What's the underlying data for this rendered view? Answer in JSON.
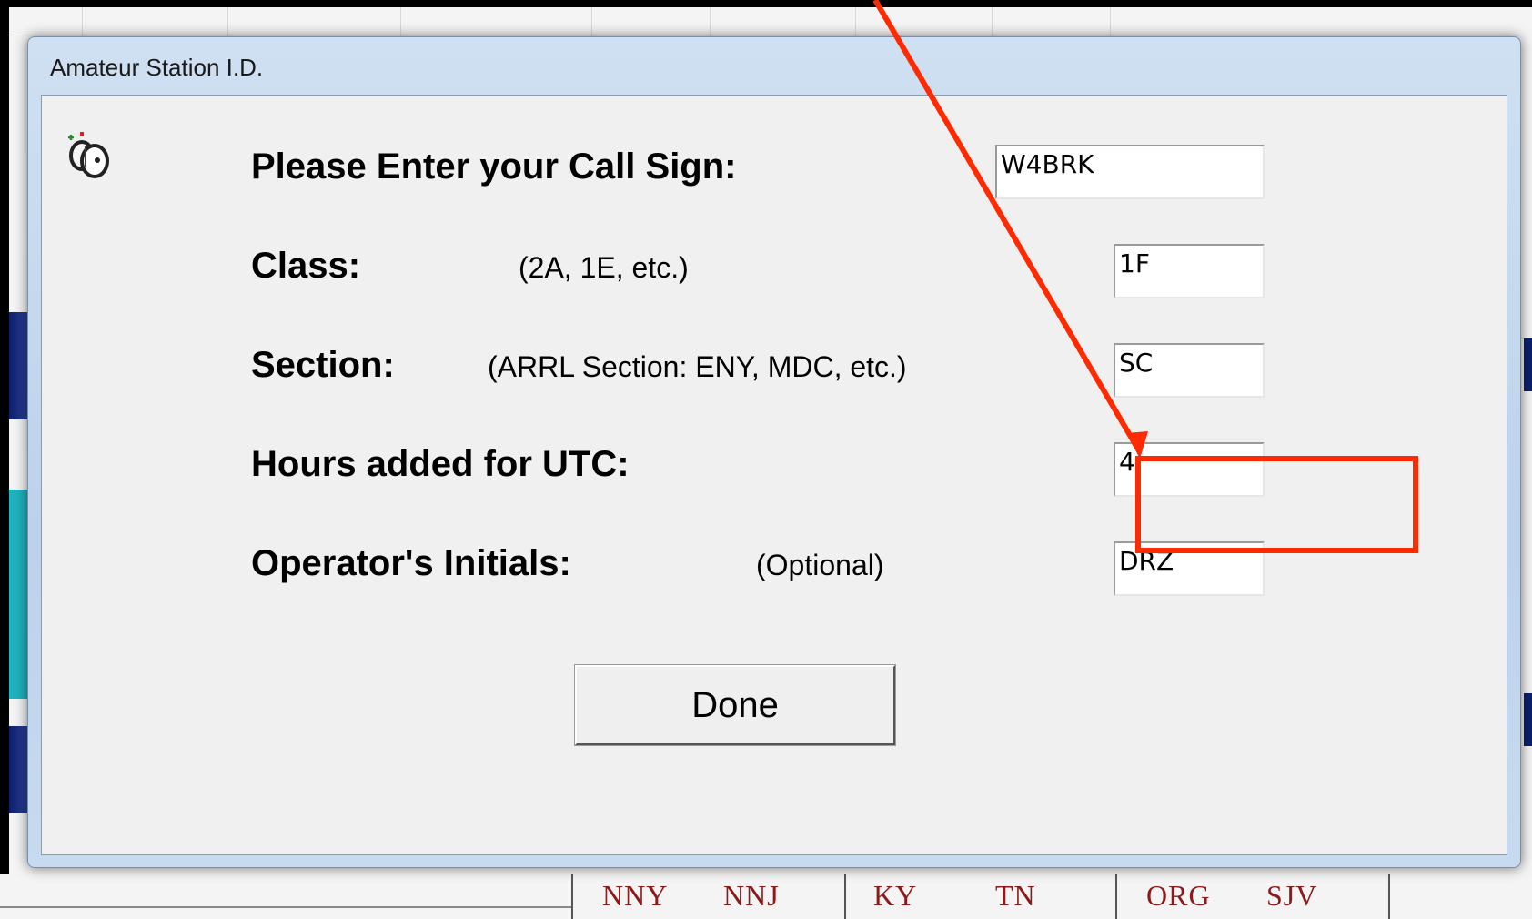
{
  "dialog": {
    "title": "Amateur Station I.D.",
    "fields": {
      "call_sign": {
        "label": "Please Enter your Call Sign:",
        "value": "W4BRK"
      },
      "class": {
        "label": "Class:",
        "hint": "(2A, 1E, etc.)",
        "value": "1F"
      },
      "section": {
        "label": "Section:",
        "hint": "(ARRL Section: ENY, MDC, etc.)",
        "value": "SC"
      },
      "utc_hours": {
        "label": "Hours added for UTC:",
        "value": "4"
      },
      "operator_initials": {
        "label": "Operator's Initials:",
        "hint": "(Optional)",
        "value": "DRZ"
      }
    },
    "done_label": "Done"
  },
  "background": {
    "bottom_row_labels": [
      "NNY",
      "NNJ",
      "KY",
      "TN",
      "ORG",
      "SJV"
    ]
  },
  "annotation": {
    "color": "#ff2a00",
    "highlighted_field": "utc_hours"
  },
  "colors": {
    "window_frame": "#bcd2ea",
    "client_area": "#f0f0f0",
    "section_text_red": "#8b1a1a"
  },
  "icons": {
    "app_icon": "key-cursor-icon"
  }
}
